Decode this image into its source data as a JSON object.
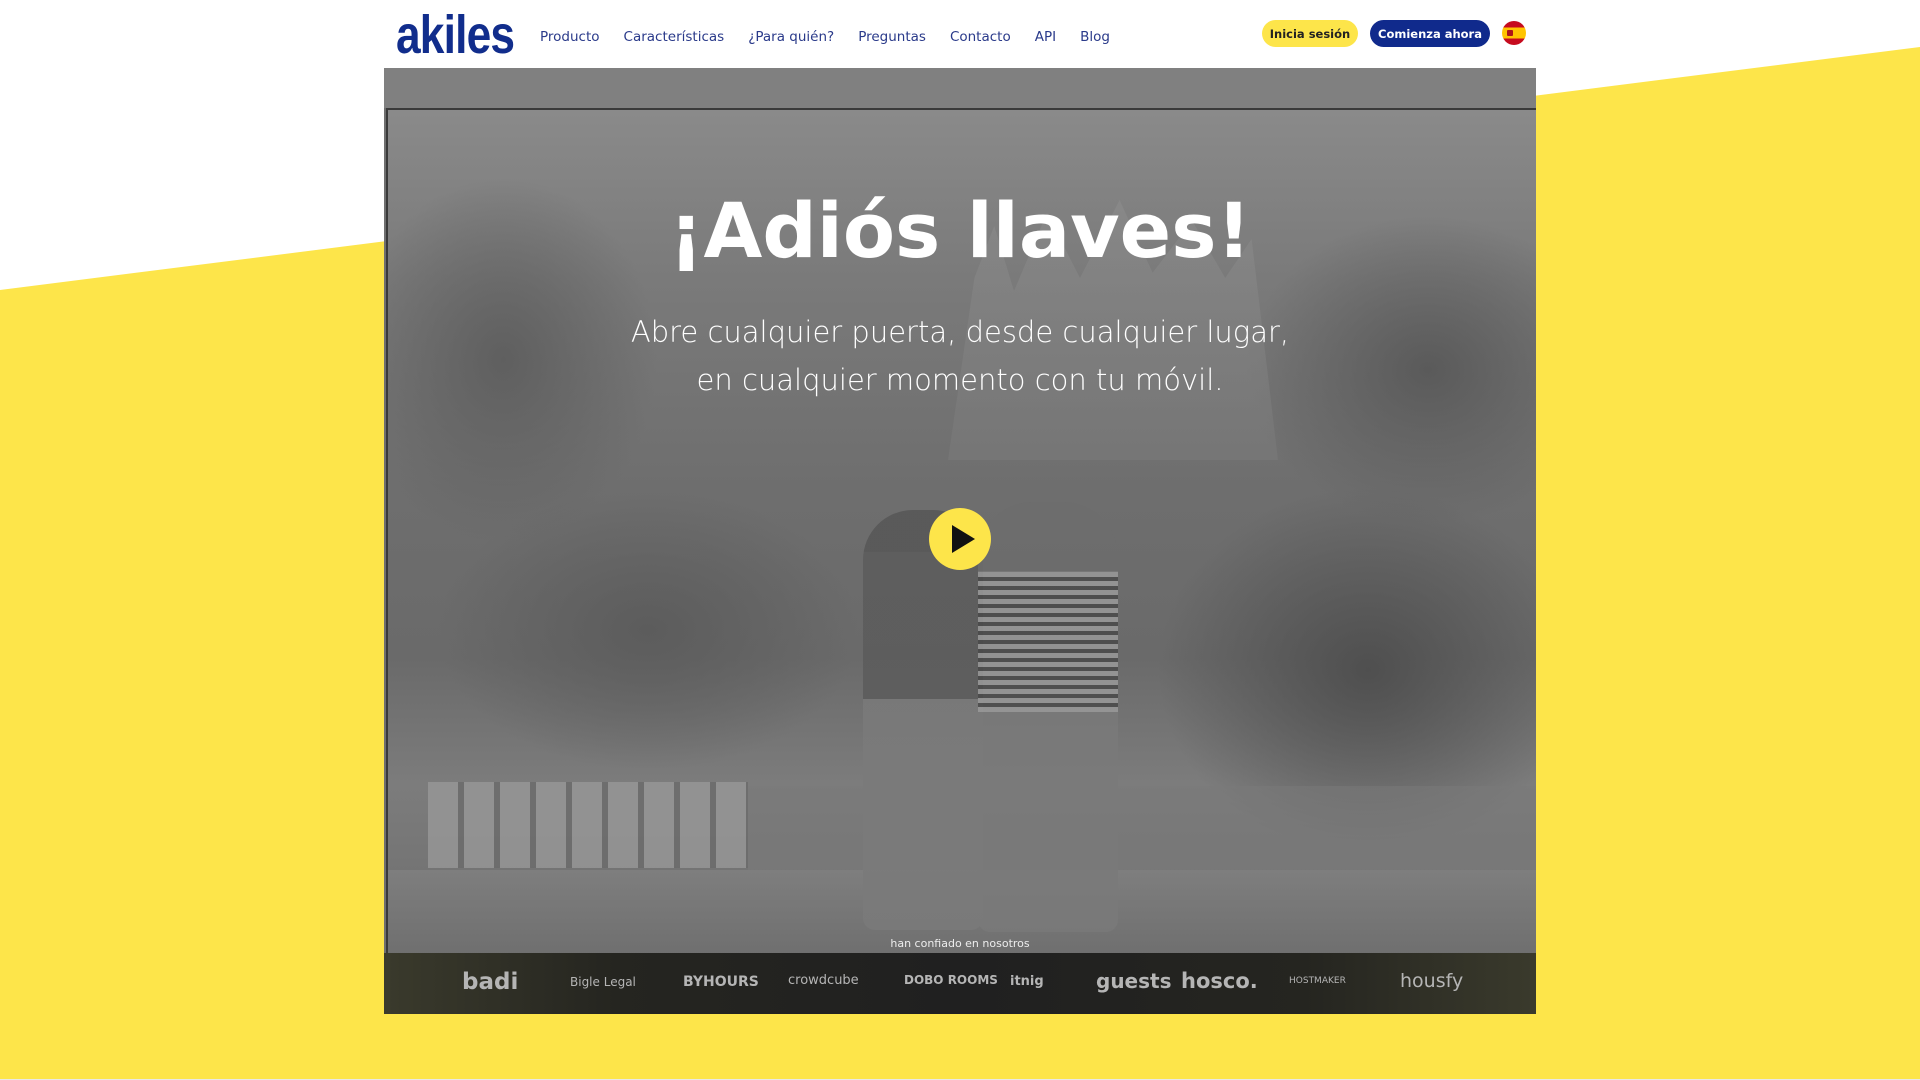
{
  "brand": {
    "logo_text": "akiles",
    "accent_yellow": "#fde54a",
    "accent_blue": "#112d8c"
  },
  "nav": {
    "items": [
      "Producto",
      "Características",
      "¿Para quién?",
      "Preguntas",
      "Contacto",
      "API",
      "Blog"
    ]
  },
  "header_actions": {
    "login_label": "Inicia sesión",
    "start_label": "Comienza ahora",
    "language_flag": "spain-flag-icon"
  },
  "hero": {
    "title": "¡Adiós llaves!",
    "subtitle_line1": "Abre cualquier puerta, desde cualquier lugar,",
    "subtitle_line2": "en cualquier momento con tu móvil.",
    "play_icon": "play-icon"
  },
  "clients": {
    "caption": "han confiado en nosotros",
    "logos": [
      "badi",
      "Bigle Legal",
      "BYHOURS",
      "crowdcube",
      "DOBO ROOMS",
      "itnig",
      "guests",
      "hosco.",
      "HOSTMAKER",
      "housfy"
    ]
  }
}
